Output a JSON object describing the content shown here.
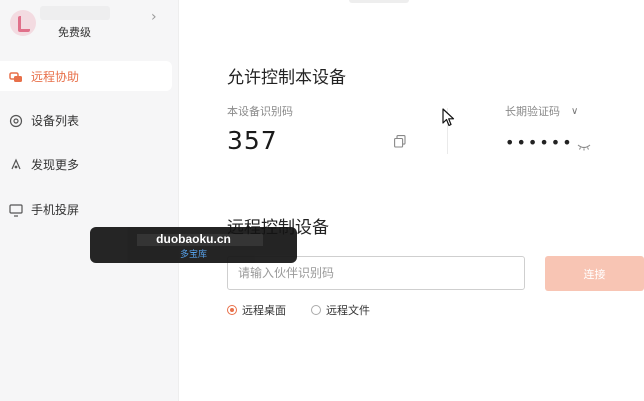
{
  "sidebar": {
    "profile": {
      "tier": "免费级"
    },
    "items": [
      {
        "label": "远程协助",
        "icon": "remote-assist-icon",
        "active": true
      },
      {
        "label": "设备列表",
        "icon": "device-list-icon",
        "active": false
      },
      {
        "label": "发现更多",
        "icon": "discover-icon",
        "active": false
      },
      {
        "label": "手机投屏",
        "icon": "screen-cast-icon",
        "active": false
      }
    ]
  },
  "allow_control": {
    "title": "允许控制本设备",
    "device_id_label": "本设备识别码",
    "device_id": "357",
    "password_label": "长期验证码",
    "password": "••••••"
  },
  "remote_control": {
    "title": "远程控制设备",
    "input_placeholder": "请输入伙伴识别码",
    "connect_label": "连接",
    "options": [
      {
        "label": "远程桌面",
        "selected": true
      },
      {
        "label": "远程文件",
        "selected": false
      }
    ]
  },
  "watermark": {
    "site": "duobaoku.cn",
    "name": "多宝库"
  },
  "colors": {
    "accent": "#e8704a",
    "button_disabled": "#f8c5b4",
    "sidebar_bg": "#f6f6f7"
  }
}
